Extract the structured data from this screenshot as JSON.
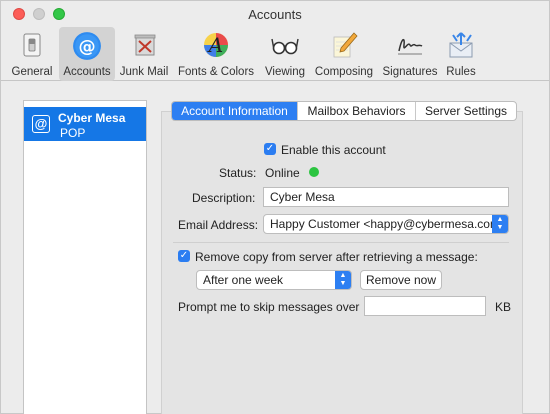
{
  "window": {
    "title": "Accounts"
  },
  "toolbar": {
    "items": [
      {
        "label": "General",
        "icon": "switch-icon"
      },
      {
        "label": "Accounts",
        "icon": "at-sign-icon",
        "active": true
      },
      {
        "label": "Junk Mail",
        "icon": "trash-bin-icon"
      },
      {
        "label": "Fonts & Colors",
        "icon": "font-palette-icon"
      },
      {
        "label": "Viewing",
        "icon": "glasses-icon"
      },
      {
        "label": "Composing",
        "icon": "pencil-icon"
      },
      {
        "label": "Signatures",
        "icon": "signature-icon"
      },
      {
        "label": "Rules",
        "icon": "envelope-arrows-icon"
      }
    ]
  },
  "sidebar": {
    "accounts": [
      {
        "name": "Cyber Mesa",
        "type": "POP",
        "selected": true
      }
    ]
  },
  "tabs": [
    {
      "label": "Account Information",
      "active": true
    },
    {
      "label": "Mailbox Behaviors"
    },
    {
      "label": "Server Settings"
    }
  ],
  "form": {
    "enable_label": "Enable this account",
    "enable_checked": true,
    "status_label": "Status:",
    "status_value": "Online",
    "status_color": "#2bc440",
    "description_label": "Description:",
    "description_value": "Cyber Mesa",
    "email_label": "Email Address:",
    "email_value": "Happy Customer <happy@cybermesa.com>",
    "remove_copy_label": "Remove copy from server after retrieving a message:",
    "remove_copy_checked": true,
    "remove_after_value": "After one week",
    "remove_now_label": "Remove now",
    "prompt_label": "Prompt me to skip messages over",
    "prompt_value": "",
    "prompt_unit": "KB"
  },
  "colors": {
    "accent": "#2d7ff2",
    "selection": "#1577e6"
  }
}
